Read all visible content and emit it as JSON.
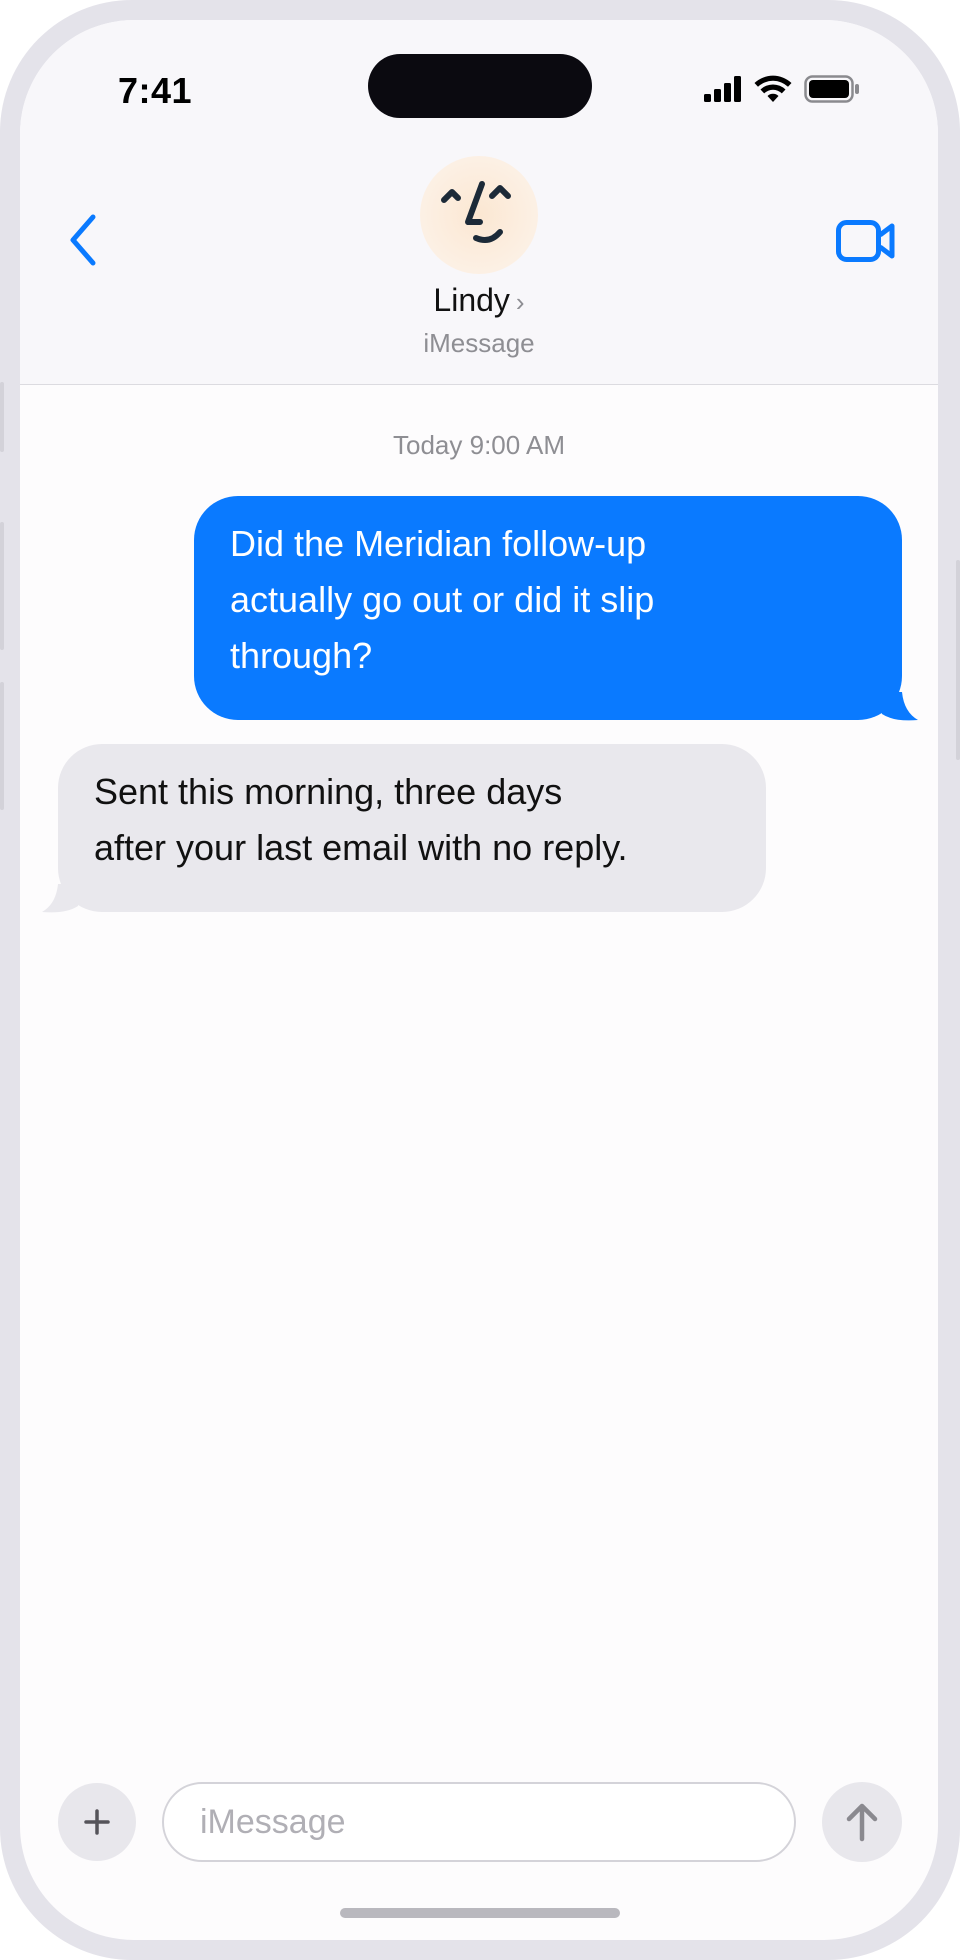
{
  "status_bar": {
    "time": "7:41",
    "icons": [
      "signal-icon",
      "wifi-icon",
      "battery-icon"
    ]
  },
  "header": {
    "back_icon": "chevron-left-icon",
    "contact_name": "Lindy",
    "contact_chevron": "›",
    "service": "iMessage",
    "video_icon": "video-camera-icon",
    "avatar_icon": "memoji-face-icon"
  },
  "conversation": {
    "timestamp": "Today 9:00 AM",
    "messages": [
      {
        "direction": "sent",
        "lines": [
          "Did the Meridian follow-up",
          "actually go out or did it slip",
          "through?"
        ]
      },
      {
        "direction": "received",
        "lines": [
          "Sent this morning, three days",
          "after your last email with no reply."
        ]
      }
    ]
  },
  "input_bar": {
    "plus_label": "+",
    "placeholder": "iMessage",
    "send_icon": "arrow-up-icon"
  },
  "colors": {
    "accent": "#0a7aff",
    "sent_bubble": "#0a7aff",
    "received_bubble": "#e9e8ed",
    "secondary_text": "#8e8e93"
  }
}
